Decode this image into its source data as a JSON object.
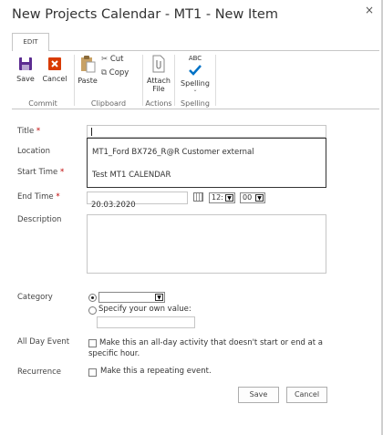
{
  "dialog": {
    "title": "New Projects Calendar - MT1 - New Item",
    "close_glyph": "×"
  },
  "ribbon": {
    "tab_label": "EDIT",
    "save_label": "Save",
    "cancel_label": "Cancel",
    "commit_group": "Commit",
    "paste_label": "Paste",
    "cut_label": "Cut",
    "copy_label": "Copy",
    "clipboard_group": "Clipboard",
    "attach_label_1": "Attach",
    "attach_label_2": "File",
    "actions_group": "Actions",
    "spelling_top": "ABC",
    "spelling_label": "Spelling",
    "spelling_group": "Spelling"
  },
  "form": {
    "title_label": "Title",
    "required_mark": "*",
    "title_value": "",
    "location_label": "Location",
    "autocomplete_item_1": "MT1_Ford BX726_R@R Customer external",
    "start_label": "Start Time",
    "autocomplete_item_2": "Test MT1 CALENDAR",
    "end_label": "End Time",
    "end_date": "20.03.2020",
    "end_hour": "12:",
    "end_minute": "00",
    "description_label": "Description",
    "category_label": "Category",
    "category_selected": "",
    "specify_label": "Specify your own value:",
    "allday_label": "All Day Event",
    "allday_text": "Make this an all-day activity that doesn't start or end at a specific hour.",
    "recurrence_label": "Recurrence",
    "recurrence_text": "Make this a repeating event.",
    "save_button": "Save",
    "cancel_button": "Cancel"
  },
  "colors": {
    "save_icon": "#5c2d91",
    "cancel_icon": "#d83b01",
    "spelling_check": "#0072c6",
    "required": "#bf0000"
  }
}
